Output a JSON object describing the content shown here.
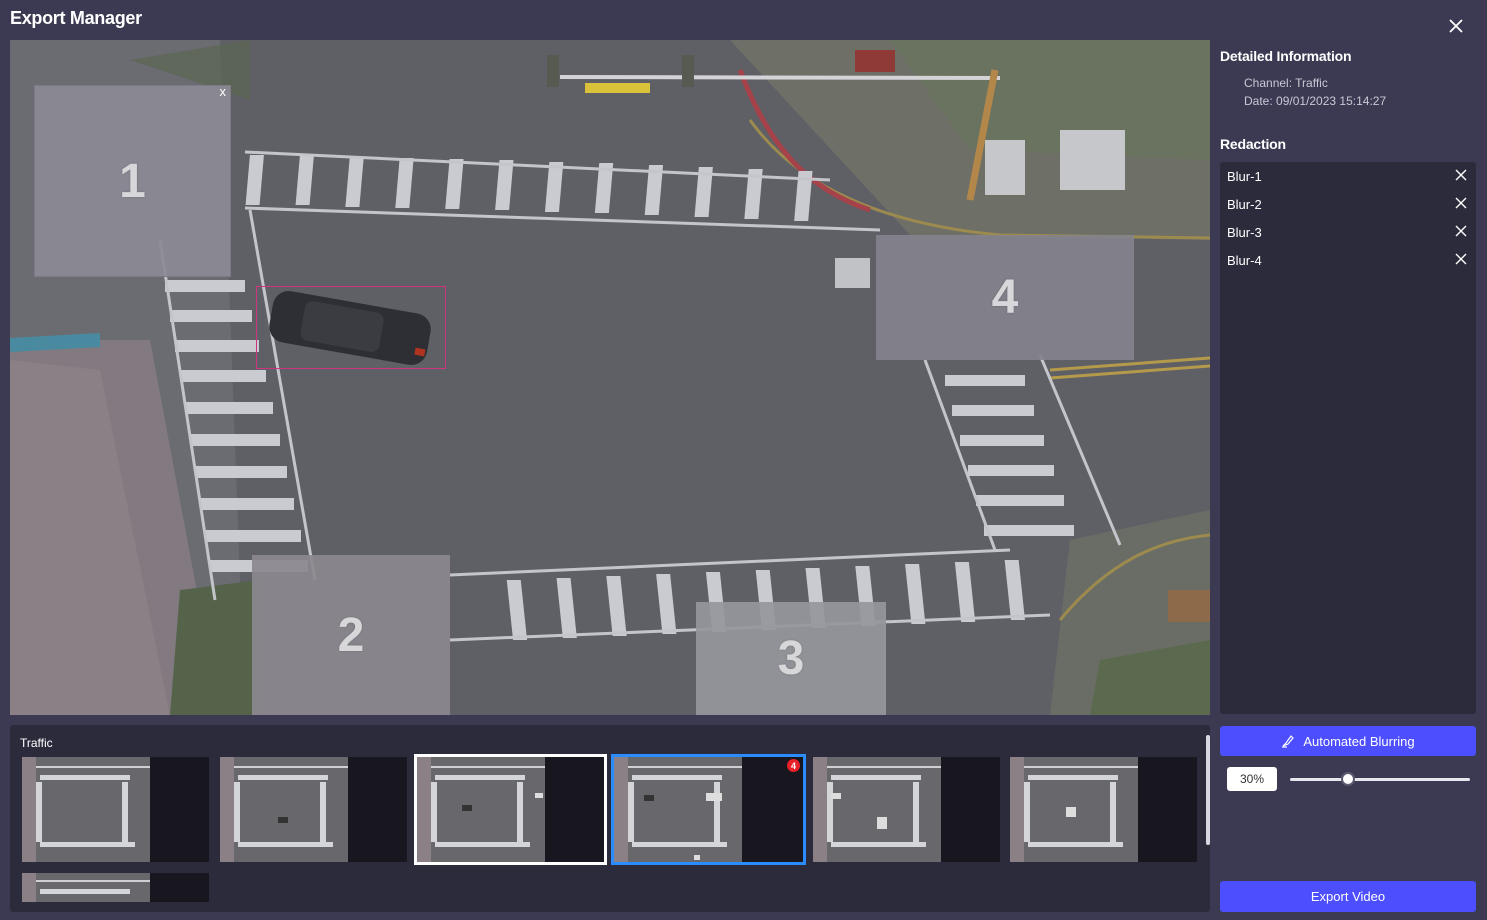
{
  "window": {
    "title": "Export Manager"
  },
  "icons": {
    "close": "close-icon",
    "remove": "close-icon",
    "auto_blur": "brush-icon"
  },
  "viewport": {
    "blur_regions": [
      {
        "label": "1",
        "close": "x"
      },
      {
        "label": "2"
      },
      {
        "label": "3"
      },
      {
        "label": "4"
      }
    ]
  },
  "details": {
    "heading": "Detailed Information",
    "channel": "Channel: Traffic",
    "date": "Date: 09/01/2023 15:14:27"
  },
  "redaction": {
    "heading": "Redaction",
    "items": [
      "Blur-1",
      "Blur-2",
      "Blur-3",
      "Blur-4"
    ]
  },
  "controls": {
    "auto_blur_label": "Automated Blurring",
    "blur_percent": "30%",
    "blur_level": 0.3,
    "export_label": "Export Video"
  },
  "timeline": {
    "channel_label": "Traffic",
    "selected_badge": "4"
  },
  "colors": {
    "accent": "#4d4fff",
    "selected_blue": "#2a8cff",
    "detect_box": "#d2337f",
    "badge_red": "#e8202a"
  }
}
